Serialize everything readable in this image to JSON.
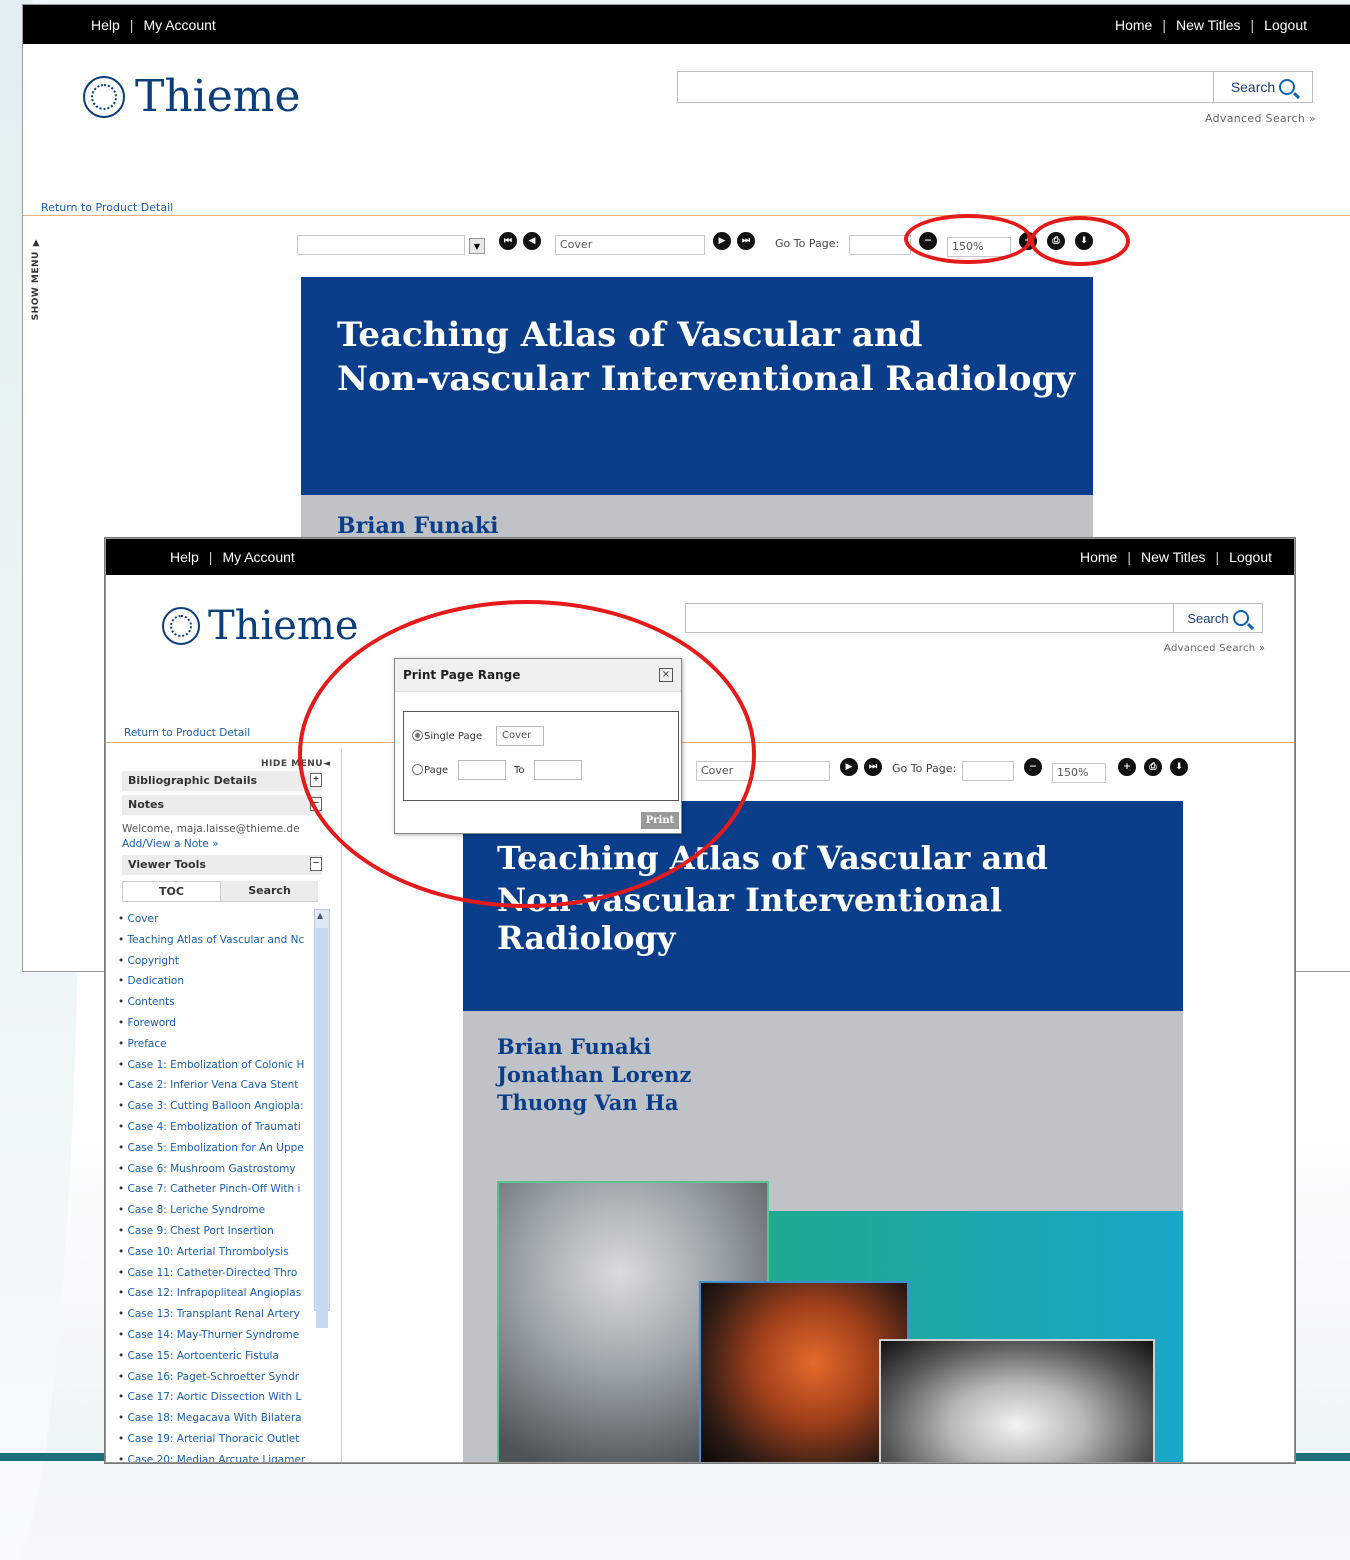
{
  "colors": {
    "brand": "#0b3e8a",
    "annotation": "#e51a1a",
    "link": "#1a5fae",
    "accent_line": "#f0b080"
  },
  "header": {
    "help": "Help",
    "account": "My Account",
    "home": "Home",
    "new_titles": "New Titles",
    "logout": "Logout"
  },
  "logo": {
    "text": "Thieme",
    "icon": "thieme-flower-icon"
  },
  "search": {
    "button": "Search",
    "value": "",
    "advanced": "Advanced Search »"
  },
  "return_link": "Return to Product Detail",
  "show_menu": "SHOW MENU ▼",
  "hide_menu": "HIDE MENU◄",
  "toolbar": {
    "page_value": "Cover",
    "go_to_page": "Go To Page:",
    "zoom": "150%"
  },
  "book": {
    "title_line1": "Teaching Atlas of Vascular and",
    "title_line2": "Non-vascular Interventional Radiology",
    "authors": [
      "Brian Funaki",
      "Jonathan Lorenz",
      "Thuong Van Ha"
    ]
  },
  "sidebar": {
    "bibliographic": "Bibliographic Details",
    "notes": "Notes",
    "welcome": "Welcome, maja.laisse@thieme.de",
    "add_note": "Add/View a Note »",
    "viewer_tools": "Viewer Tools",
    "tabs": [
      "TOC",
      "Search"
    ],
    "toc": [
      "Cover",
      "Teaching Atlas of Vascular and Nc",
      "Copyright",
      "Dedication",
      "Contents",
      "Foreword",
      "Preface",
      "Case 1: Embolization of Colonic H",
      "Case 2: Inferior Vena Cava Stent",
      "Case 3: Cutting Balloon Angiopla:",
      "Case 4: Embolization of Traumati",
      "Case 5: Embolization for An Uppe",
      "Case 6: Mushroom Gastrostomy",
      "Case 7: Catheter Pinch-Off With i",
      "Case 8: Leriche Syndrome",
      "Case 9: Chest Port Insertion",
      "Case 10: Arterial Thrombolysis",
      "Case 11: Catheter-Directed Thro",
      "Case 12: Infrapopliteal Angioplas",
      "Case 13: Transplant Renal Artery",
      "Case 14: May-Thurner Syndrome",
      "Case 15: Aortoenteric Fistula",
      "Case 16: Paget-Schroetter Syndr",
      "Case 17: Aortic Dissection With L",
      "Case 18: Megacava With Bilatera",
      "Case 19: Arterial Thoracic Outlet",
      "Case 20: Median Arcuate Ligamer"
    ]
  },
  "dialog": {
    "title": "Print Page Range",
    "single_page": "Single Page",
    "single_value": "Cover",
    "page": "Page",
    "to": "To",
    "print": "Print"
  }
}
